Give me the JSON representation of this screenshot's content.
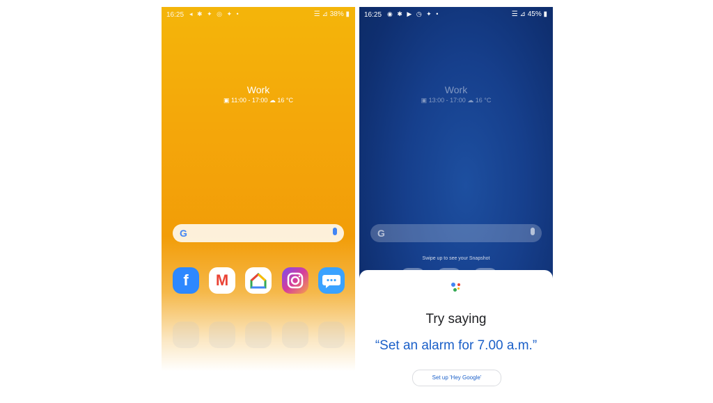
{
  "left_phone": {
    "status": {
      "time": "16:25",
      "notifications": "◂ ✱ ✦ ◎ ✦ •",
      "right": "☰ ⊿ 38% ▮"
    },
    "widget": {
      "title": "Work",
      "subtitle": "▣ 11:00 - 17:00   ☁ 16 °C"
    },
    "search": {
      "logo": "G"
    },
    "apps": [
      {
        "name": "Facebook",
        "glyph": "f"
      },
      {
        "name": "Gmail",
        "glyph": "M"
      },
      {
        "name": "Home",
        "glyph": "⌂"
      },
      {
        "name": "Instagram",
        "glyph": "◎"
      },
      {
        "name": "Messages",
        "glyph": "…"
      }
    ]
  },
  "right_phone": {
    "status": {
      "time": "16:25",
      "notifications": "◉ ✱ ▶ ◷ ✦ •",
      "right": "☰ ⊿ 45% ▮"
    },
    "widget": {
      "title": "Work",
      "subtitle": "▣ 13:00 - 17:00   ☁ 16 °C"
    },
    "search": {
      "logo": "G"
    },
    "swipe_hint": "Swipe up to see your Snapshot",
    "assistant": {
      "heading": "Try saying",
      "suggestion": "“Set an alarm for 7.00 a.m.”",
      "setup_button": "Set up 'Hey Google'"
    }
  },
  "colors": {
    "left_wallpaper": "#f4a70a",
    "right_wallpaper": "#163f8c",
    "assistant_blue": "#1a5fc8"
  }
}
